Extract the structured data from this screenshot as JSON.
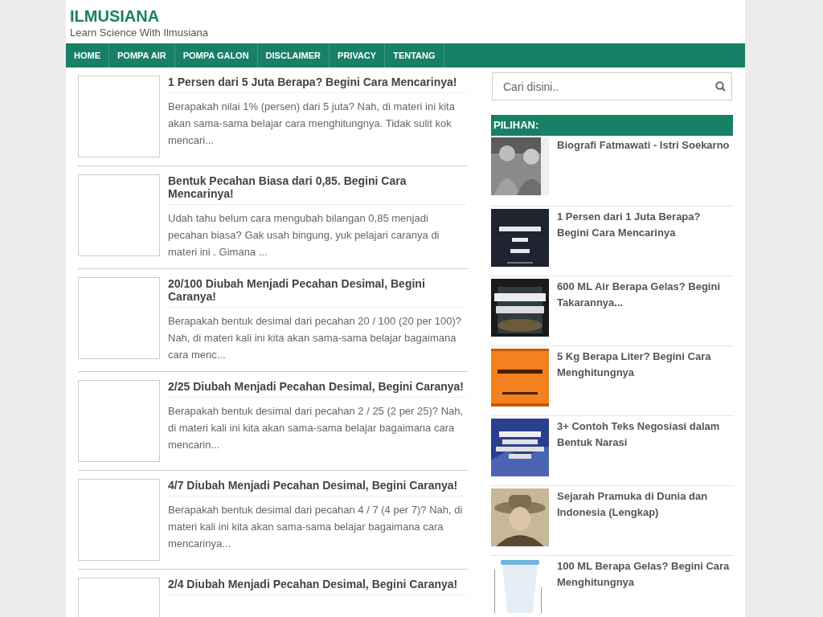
{
  "site": {
    "title": "ILMUSIANA",
    "tagline": "Learn Science With Ilmusiana"
  },
  "nav": [
    "HOME",
    "POMPA AIR",
    "POMPA GALON",
    "DISCLAIMER",
    "PRIVACY",
    "TENTANG"
  ],
  "posts": [
    {
      "title": "1 Persen dari 5 Juta Berapa? Begini Cara Mencarinya!",
      "excerpt": "Berapakah nilai 1% (persen) dari 5 juta? Nah, di materi ini kita akan sama-sama belajar cara menghitungnya. Tidak sulit kok mencari..."
    },
    {
      "title": "Bentuk Pecahan Biasa dari 0,85. Begini Cara Mencarinya!",
      "excerpt": "Udah tahu belum cara mengubah bilangan 0,85 menjadi pecahan biasa? Gak usah bingung, yuk pelajari caranya di materi ini . Gimana ..."
    },
    {
      "title": "20/100 Diubah Menjadi Pecahan Desimal, Begini Caranya!",
      "excerpt": "Berapakah bentuk desimal dari pecahan 20 / 100 (20 per 100)? Nah, di materi kali ini kita akan sama-sama belajar bagaimana cara menc..."
    },
    {
      "title": "2/25 Diubah Menjadi Pecahan Desimal, Begini Caranya!",
      "excerpt": "Berapakah bentuk desimal dari pecahan 2 / 25 (2 per 25)? Nah, di materi kali ini kita akan sama-sama belajar bagaimana cara mencarin..."
    },
    {
      "title": "4/7 Diubah Menjadi Pecahan Desimal, Begini Caranya!",
      "excerpt": "Berapakah bentuk desimal dari pecahan 4 / 7 (4 per 7)? Nah, di materi kali ini kita akan sama-sama belajar bagaimana cara mencarinya..."
    },
    {
      "title": "2/4 Diubah Menjadi Pecahan Desimal, Begini Caranya!"
    }
  ],
  "search": {
    "placeholder": "Cari disini.."
  },
  "sidebar": {
    "heading": "PILIHAN:",
    "items": [
      {
        "title": "Biografi Fatmawati - Istri Soekarno"
      },
      {
        "title": "1 Persen dari 1 Juta Berapa? Begini Cara Mencarinya"
      },
      {
        "title": "600 ML Air Berapa Gelas? Begini Takarannya..."
      },
      {
        "title": "5 Kg Berapa Liter? Begini Cara Menghitungnya"
      },
      {
        "title": "3+ Contoh Teks Negosiasi dalam Bentuk Narasi"
      },
      {
        "title": "Sejarah Pramuka di Dunia dan Indonesia (Lengkap)"
      },
      {
        "title": "100 ML Berapa Gelas? Begini Cara Menghitungnya"
      }
    ]
  }
}
